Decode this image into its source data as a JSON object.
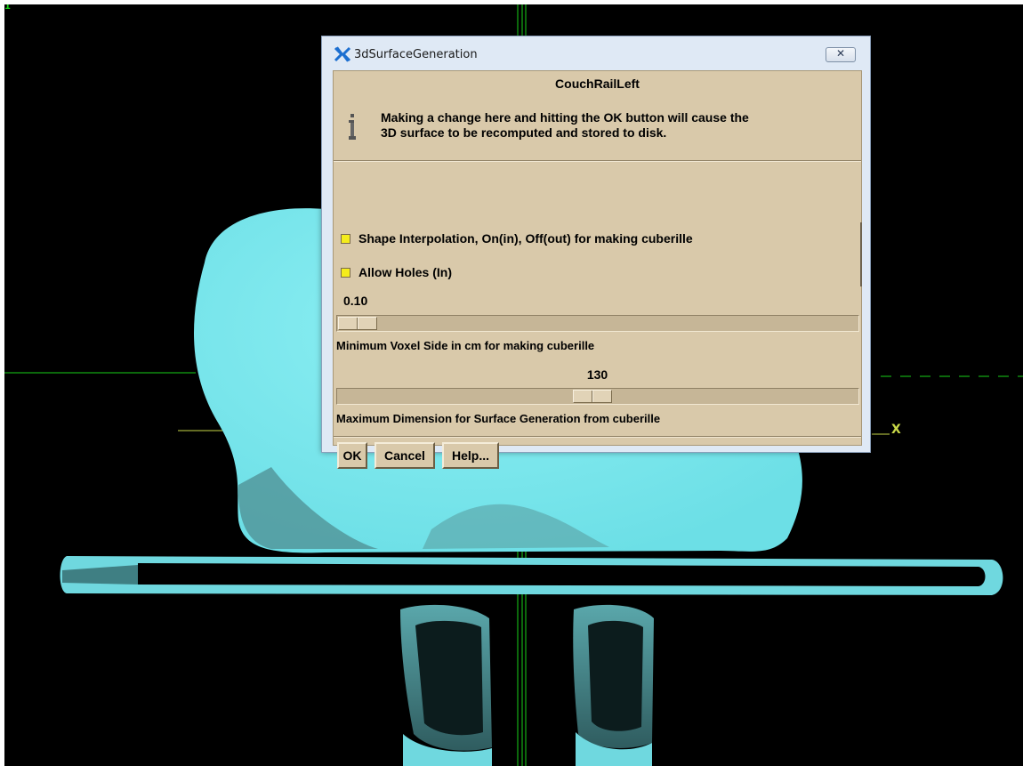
{
  "viewer": {
    "corner_label": "1",
    "x_axis_label": "X"
  },
  "dialog": {
    "title": "3dSurfaceGeneration",
    "close_icon": "close-icon",
    "subject": "CouchRailLeft",
    "info_icon": "info-icon",
    "info_lines": [
      "Making a change here and hitting the OK button will cause the",
      "3D surface to be recomputed and stored to disk."
    ],
    "options": [
      {
        "label": "Shape Interpolation, On(in), Off(out) for making cuberille",
        "checked": true
      },
      {
        "label": "Allow Holes (In)",
        "checked": true
      }
    ],
    "voxel_slider": {
      "value": "0.10",
      "label": "Minimum Voxel Side in cm for making cuberille"
    },
    "dimension_slider": {
      "value": "130",
      "label": "Maximum Dimension for Surface Generation from cuberille"
    },
    "buttons": {
      "ok": "OK",
      "cancel": "Cancel",
      "help": "Help..."
    },
    "colors": {
      "surface": "#7ce8ee",
      "panel": "#d9c9aa",
      "checkbox": "#f4ec1c",
      "crosshair": "#18d018"
    }
  }
}
